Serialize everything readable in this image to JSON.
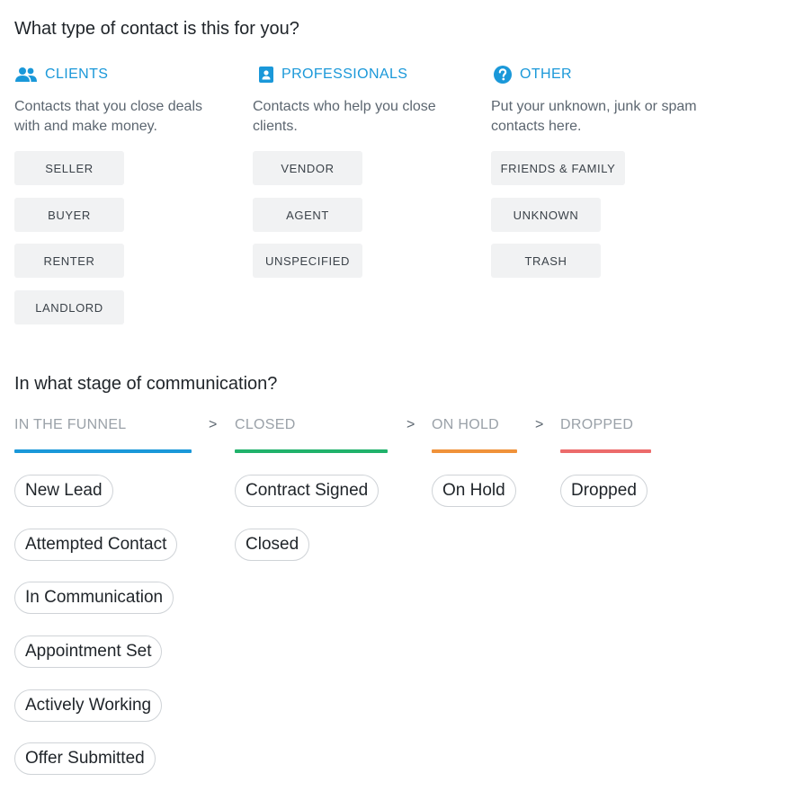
{
  "type_section": {
    "heading": "What type of contact is this for you?",
    "accent_color": "#1a98d9",
    "categories": [
      {
        "icon": "people-icon",
        "label": "CLIENTS",
        "description": "Contacts that you close deals with and make money.",
        "options": [
          "SELLER",
          "BUYER",
          "RENTER",
          "LANDLORD"
        ]
      },
      {
        "icon": "contact-card-icon",
        "label": "PROFESSIONALS",
        "description": "Contacts who help you close clients.",
        "options": [
          "VENDOR",
          "AGENT",
          "UNSPECIFIED"
        ]
      },
      {
        "icon": "question-circle-icon",
        "label": "OTHER",
        "description": "Put your unknown, junk or spam contacts here.",
        "options": [
          "FRIENDS & FAMILY",
          "UNKNOWN",
          "TRASH"
        ]
      }
    ]
  },
  "stage_section": {
    "heading": "In what stage of communication?",
    "separator": ">",
    "columns": [
      {
        "label": "IN THE FUNNEL",
        "color": "#1a98d9",
        "stages": [
          "New Lead",
          "Attempted Contact",
          "In Communication",
          "Appointment Set",
          "Actively Working",
          "Offer Submitted"
        ]
      },
      {
        "label": "CLOSED",
        "color": "#20b26b",
        "stages": [
          "Contract Signed",
          "Closed"
        ]
      },
      {
        "label": "ON HOLD",
        "color": "#f0923a",
        "stages": [
          "On Hold"
        ]
      },
      {
        "label": "DROPPED",
        "color": "#ec6b6b",
        "stages": [
          "Dropped"
        ]
      }
    ]
  }
}
